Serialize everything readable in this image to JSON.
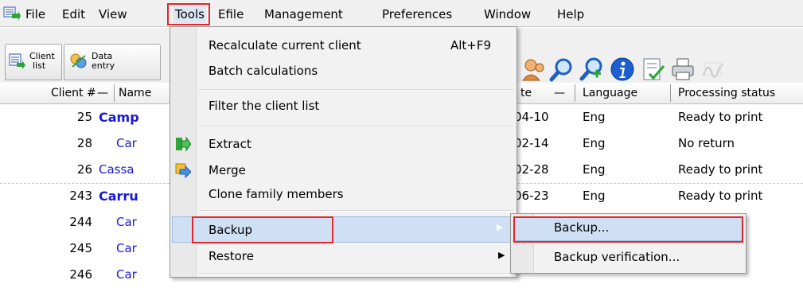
{
  "menubar": {
    "items": [
      {
        "label": "File"
      },
      {
        "label": "Edit"
      },
      {
        "label": "View"
      },
      {
        "label": "Tools"
      },
      {
        "label": "Efile"
      },
      {
        "label": "Management"
      },
      {
        "label": "Preferences"
      },
      {
        "label": "Window"
      },
      {
        "label": "Help"
      }
    ]
  },
  "toolbar": {
    "client_list_line1": "Client",
    "client_list_line2": "list",
    "data_entry_line1": "Data",
    "data_entry_line2": "entry"
  },
  "table": {
    "headers": {
      "client_no": "Client #",
      "name": "Name",
      "date": "te",
      "language": "Language",
      "status": "Processing status"
    },
    "rows": [
      {
        "num": "25",
        "name": "Camp",
        "date": "04-10",
        "lang": "Eng",
        "status": "Ready to print",
        "bold": true
      },
      {
        "num": "28",
        "name": "Car",
        "date": "02-14",
        "lang": "Eng",
        "status": "No return",
        "bold": false
      },
      {
        "num": "26",
        "name": "Cassa",
        "date": "02-28",
        "lang": "Eng",
        "status": "Ready to print",
        "bold": false
      },
      {
        "num": "243",
        "name": "Carru",
        "date": "06-23",
        "lang": "Eng",
        "status": "Ready to print",
        "bold": true
      },
      {
        "num": "244",
        "name": "Car",
        "date": "",
        "lang": "",
        "status": "",
        "bold": false
      },
      {
        "num": "245",
        "name": "Car",
        "date": "",
        "lang": "",
        "status": "",
        "bold": false
      },
      {
        "num": "246",
        "name": "Car",
        "date": "",
        "lang": "",
        "status": "",
        "bold": false
      }
    ]
  },
  "tools_menu": {
    "recalc_label": "Recalculate current client",
    "recalc_shortcut": "Alt+F9",
    "batch_label": "Batch calculations",
    "filter_label": "Filter the client list",
    "extract_label": "Extract",
    "merge_label": "Merge",
    "clone_label": "Clone family members",
    "backup_label": "Backup",
    "restore_label": "Restore"
  },
  "backup_submenu": {
    "backup_label": "Backup...",
    "verify_label": "Backup verification..."
  },
  "colors": {
    "highlight_red": "#e3262b",
    "link_blue": "#1a1ad6",
    "menu_highlight": "#cfe0f5"
  }
}
